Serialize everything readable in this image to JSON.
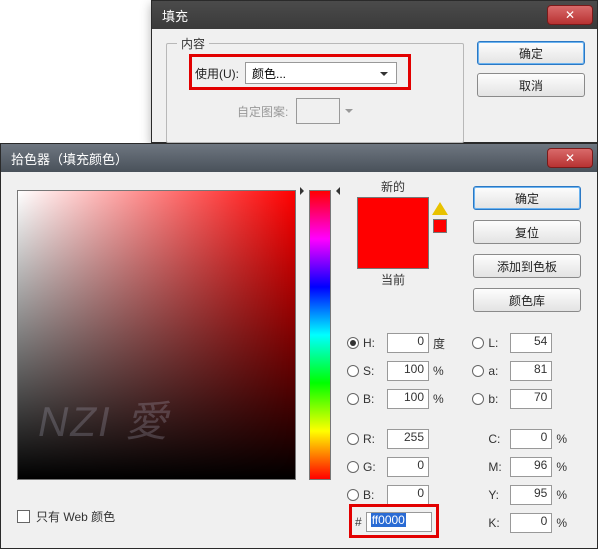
{
  "fill_dialog": {
    "title": "填充",
    "group_label": "内容",
    "use_label": "使用(U):",
    "use_value": "颜色...",
    "pattern_label": "自定图案:",
    "ok": "确定",
    "cancel": "取消"
  },
  "picker_dialog": {
    "title": "拾色器（填充颜色）",
    "new_label": "新的",
    "current_label": "当前",
    "ok": "确定",
    "reset": "复位",
    "add_swatch": "添加到色板",
    "color_lib": "颜色库",
    "web_only_label": "只有 Web 颜色",
    "hex_value": "ff0000",
    "preview_color": "#ff0000",
    "hsb": {
      "h": 0,
      "s": 100,
      "b": 100
    },
    "lab": {
      "l": 54,
      "a": 81,
      "b": 70
    },
    "rgb": {
      "r": 255,
      "g": 0,
      "b": 0
    },
    "cmyk": {
      "c": 0,
      "m": 96,
      "y": 95,
      "k": 0
    },
    "units": {
      "deg": "度",
      "pct": "%"
    },
    "labels": {
      "H": "H:",
      "S": "S:",
      "B": "B:",
      "R": "R:",
      "G": "G:",
      "Bb": "B:",
      "L": "L:",
      "a": "a:",
      "b": "b:",
      "C": "C:",
      "M": "M:",
      "Y": "Y:",
      "K": "K:",
      "hash": "#"
    }
  }
}
